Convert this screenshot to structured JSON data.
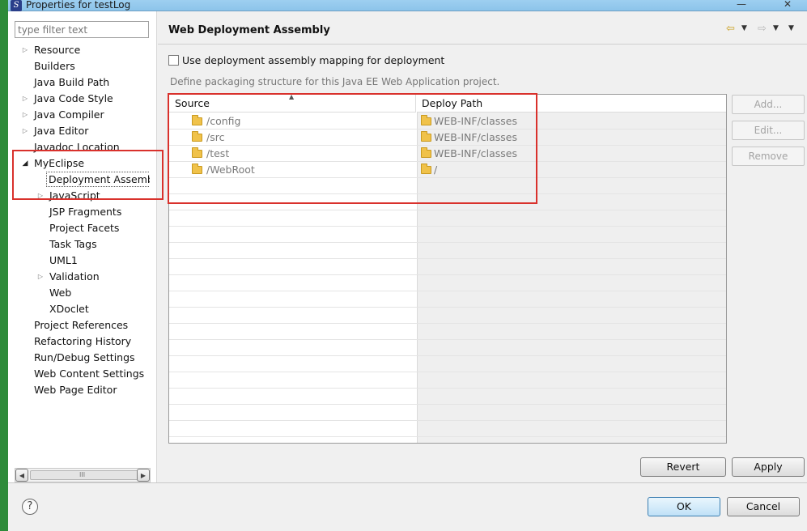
{
  "window": {
    "title": "Properties for testLog",
    "controls": [
      "—",
      "✕"
    ]
  },
  "left": {
    "filter_placeholder": "type filter text",
    "tree": [
      {
        "label": "Resource",
        "expander": "collapsed"
      },
      {
        "label": "Builders",
        "expander": "none"
      },
      {
        "label": "Java Build Path",
        "expander": "none"
      },
      {
        "label": "Java Code Style",
        "expander": "collapsed"
      },
      {
        "label": "Java Compiler",
        "expander": "collapsed"
      },
      {
        "label": "Java Editor",
        "expander": "collapsed"
      },
      {
        "label": "Javadoc Location",
        "expander": "none"
      },
      {
        "label": "MyEclipse",
        "expander": "expanded"
      },
      {
        "label": "Deployment Assembly",
        "expander": "none",
        "selected": true
      },
      {
        "label": "JavaScript",
        "expander": "collapsed"
      },
      {
        "label": "JSP Fragments",
        "expander": "none"
      },
      {
        "label": "Project Facets",
        "expander": "none"
      },
      {
        "label": "Task Tags",
        "expander": "none"
      },
      {
        "label": "UML1",
        "expander": "none"
      },
      {
        "label": "Validation",
        "expander": "collapsed"
      },
      {
        "label": "Web",
        "expander": "none"
      },
      {
        "label": "XDoclet",
        "expander": "none"
      },
      {
        "label": "Project References",
        "expander": "none"
      },
      {
        "label": "Refactoring History",
        "expander": "none"
      },
      {
        "label": "Run/Debug Settings",
        "expander": "none"
      },
      {
        "label": "Web Content Settings",
        "expander": "none"
      },
      {
        "label": "Web Page Editor",
        "expander": "none"
      }
    ],
    "scroll_left": "◀",
    "scroll_right": "▶",
    "scroll_grip": "III"
  },
  "page": {
    "title": "Web Deployment Assembly",
    "nav_back": "⇦",
    "nav_forward": "⇨",
    "nav_drop": "▼",
    "checkbox_label": "Use deployment assembly mapping for deployment",
    "checkbox_checked": false,
    "description": "Define packaging structure for this Java EE Web Application project.",
    "columns": {
      "source": "Source",
      "deploy_path": "Deploy Path",
      "sort_indicator": "▲"
    },
    "rows": [
      {
        "source": "/config",
        "deploy": "WEB-INF/classes"
      },
      {
        "source": "/src",
        "deploy": "WEB-INF/classes"
      },
      {
        "source": "/test",
        "deploy": "WEB-INF/classes"
      },
      {
        "source": "/WebRoot",
        "deploy": "/"
      }
    ],
    "side_buttons": {
      "add": "Add...",
      "edit": "Edit...",
      "remove": "Remove"
    },
    "revert": "Revert",
    "apply": "Apply"
  },
  "footer": {
    "help": "?",
    "ok": "OK",
    "cancel": "Cancel"
  },
  "colors": {
    "highlight_box": "#d9312c",
    "folder": "#f0c24a"
  }
}
